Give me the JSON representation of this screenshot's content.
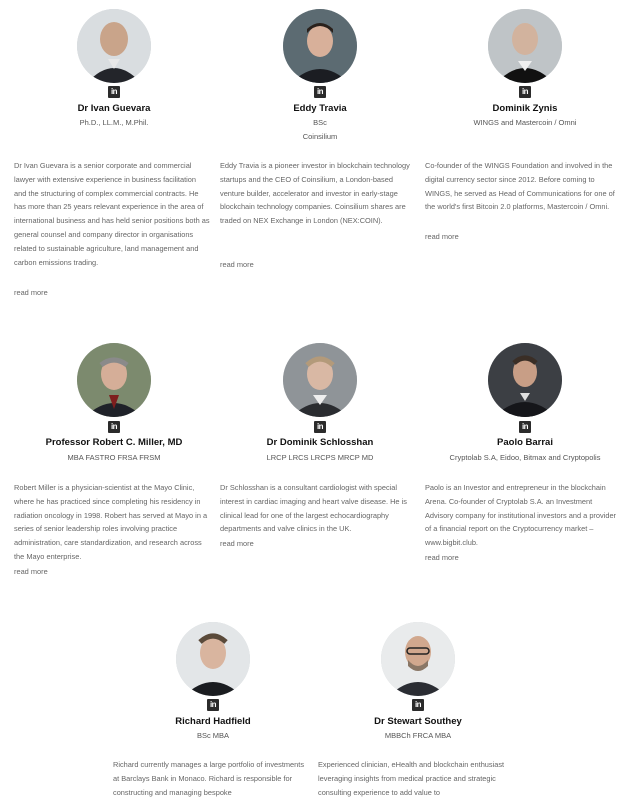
{
  "linkedin_icon_text": "in",
  "people": [
    {
      "name": "Dr Ivan Guevara",
      "title": "Ph.D., LL.M., M.Phil.",
      "org": "",
      "bio": "Dr Ivan Guevara is a senior corporate and commercial lawyer with extensive experience in business facilitation and the structuring of complex commercial contracts. He has more than 25 years relevant experience in the area of international business and has held senior positions both as general counsel and company director in organisations related to sustainable agriculture, land management and carbon emissions trading.",
      "read_more": "read more",
      "icon": "portrait-icon"
    },
    {
      "name": "Eddy Travia",
      "title": "BSc",
      "org": "Coinsilium",
      "bio": "Eddy Travia is a pioneer investor in blockchain technology startups and the CEO of Coinsilium, a London-based venture builder, accelerator and investor in early-stage blockchain technology companies. Coinsilium shares are traded on NEX Exchange in London (NEX:COIN).",
      "read_more": "read more",
      "icon": "portrait-icon"
    },
    {
      "name": "Dominik Zynis",
      "title": "WINGS and Mastercoin / Omni",
      "org": "",
      "bio": "Co-founder of the WINGS Foundation and involved in the digital currency sector since 2012. Before coming to WINGS, he served as Head of Communications for one of the world's first Bitcoin 2.0 platforms, Mastercoin / Omni.",
      "read_more": "read more",
      "icon": "portrait-icon"
    },
    {
      "name": "Professor Robert C. Miller, MD",
      "title": "MBA FASTRO FRSA FRSM",
      "org": "",
      "bio": "Robert Miller is a physician-scientist at the Mayo Clinic, where he has practiced since completing his residency in radiation oncology in 1998. Robert has served at Mayo in a series of senior leadership roles involving practice administration, care standardization, and research across the Mayo enterprise.",
      "read_more": "read more",
      "icon": "portrait-icon"
    },
    {
      "name": "Dr Dominik Schlosshan",
      "title": "LRCP LRCS LRCPS MRCP MD",
      "org": "",
      "bio": "Dr Schlosshan is a consultant cardiologist with special interest in cardiac imaging and heart valve disease. He is clinical lead for one of the largest echocardiography departments and valve clinics in the UK.",
      "read_more": "read more",
      "icon": "portrait-icon"
    },
    {
      "name": "Paolo Barrai",
      "title": "Cryptolab S.A, Eidoo, Bitmax and Cryptopolis",
      "org": "",
      "bio": "Paolo is an Investor and entrepreneur in the blockchain Arena. Co-founder of Cryptolab S.A. an Investment Advisory company for institutional investors and a provider of a financial report on the Cryptocurrency market – www.bigbit.club.",
      "read_more": "read more",
      "icon": "portrait-icon"
    },
    {
      "name": "Richard Hadfield",
      "title": "BSc MBA",
      "org": "",
      "bio": "Richard currently manages a large portfolio of investments at Barclays Bank in Monaco. Richard is responsible for constructing and managing bespoke",
      "read_more": "",
      "icon": "portrait-icon"
    },
    {
      "name": "Dr Stewart Southey",
      "title": "MBBCh FRCA MBA",
      "org": "",
      "bio": "Experienced clinician, eHealth and blockchain enthusiast leveraging insights from medical practice and strategic consulting experience to add value to",
      "read_more": "",
      "icon": "portrait-icon"
    }
  ]
}
